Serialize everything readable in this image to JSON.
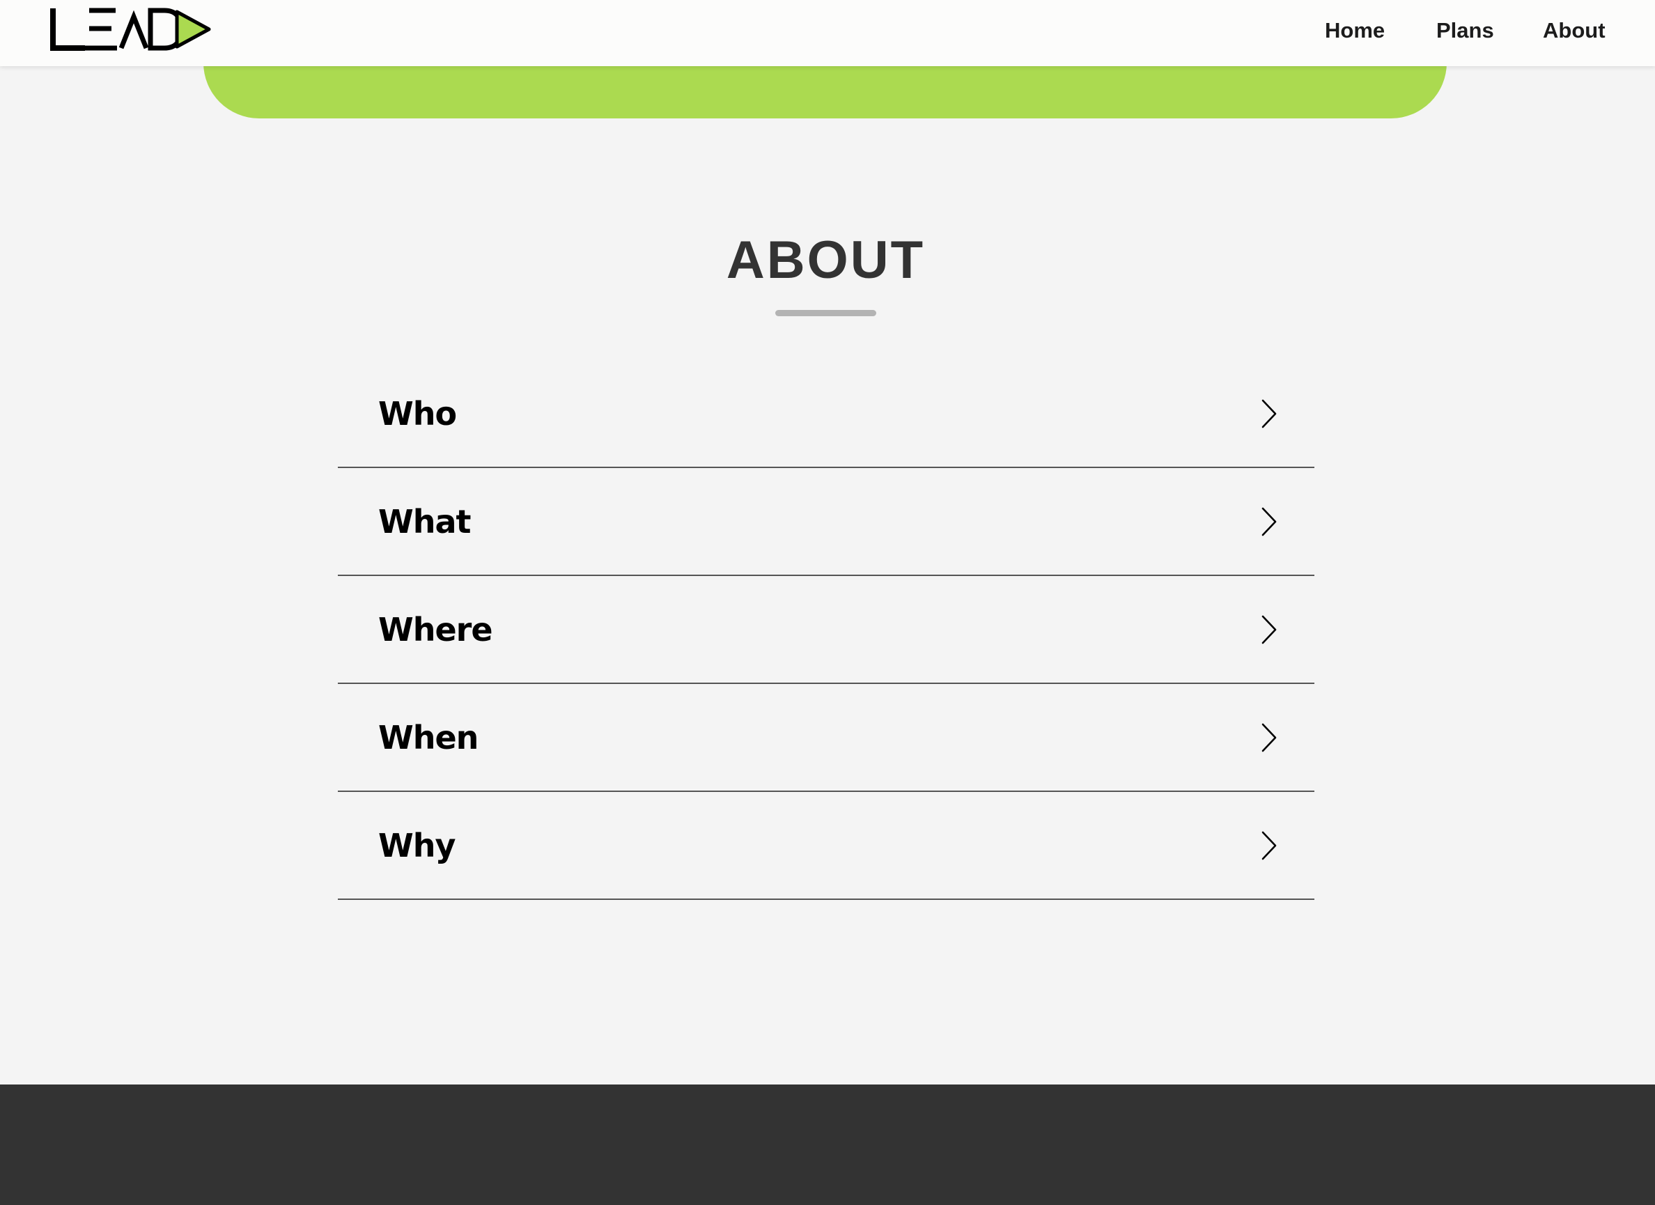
{
  "header": {
    "logo_text": "LEAD",
    "nav": {
      "home": "Home",
      "plans": "Plans",
      "about": "About"
    }
  },
  "colors": {
    "accent_green": "#abda50",
    "title_text": "#333333",
    "footer_bg": "#333333",
    "page_bg": "#f4f4f4"
  },
  "about": {
    "title": "ABOUT",
    "items": [
      {
        "label": "Who",
        "icon": "chevron-right-icon"
      },
      {
        "label": "What",
        "icon": "chevron-right-icon"
      },
      {
        "label": "Where",
        "icon": "chevron-right-icon"
      },
      {
        "label": "When",
        "icon": "chevron-right-icon"
      },
      {
        "label": "Why",
        "icon": "chevron-right-icon"
      }
    ]
  }
}
